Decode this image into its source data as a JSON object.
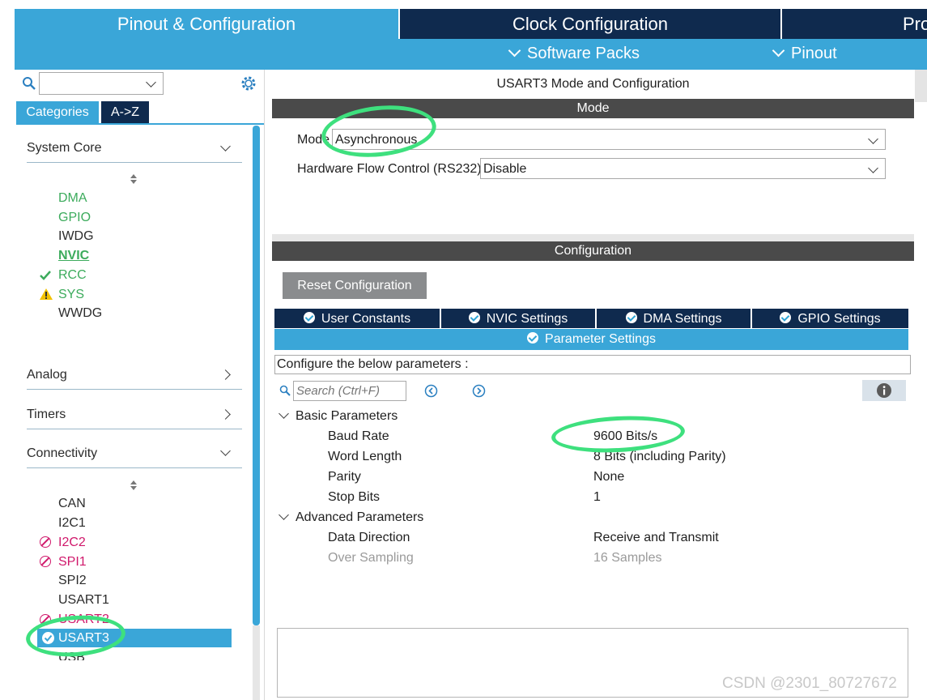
{
  "top_tabs": {
    "pinout": "Pinout & Configuration",
    "clock": "Clock Configuration",
    "project": "Pro"
  },
  "subbar": {
    "software_packs": "Software Packs",
    "pinout": "Pinout"
  },
  "sidebar": {
    "search_value": "",
    "tab_categories": "Categories",
    "tab_az": "A->Z",
    "system_core": "System Core",
    "system_core_items": [
      "DMA",
      "GPIO",
      "IWDG",
      "NVIC",
      "RCC",
      "SYS",
      "WWDG"
    ],
    "analog": "Analog",
    "timers": "Timers",
    "connectivity": "Connectivity",
    "connectivity_items": [
      "CAN",
      "I2C1",
      "I2C2",
      "SPI1",
      "SPI2",
      "USART1",
      "USART2",
      "USART3",
      "USB"
    ]
  },
  "panel": {
    "title": "USART3 Mode and Configuration",
    "mode_section": "Mode",
    "mode_label": "Mode",
    "mode_value": "Asynchronous",
    "hfc_label": "Hardware Flow Control (RS232)",
    "hfc_value": "Disable",
    "config_section": "Configuration",
    "reset_button": "Reset Configuration",
    "tabs": [
      "User Constants",
      "NVIC Settings",
      "DMA Settings",
      "GPIO Settings"
    ],
    "active_tab": "Parameter Settings",
    "configure_text": "Configure the below parameters :",
    "search_placeholder": "Search (Ctrl+F)",
    "basic_group": "Basic Parameters",
    "basic_params": [
      {
        "label": "Baud Rate",
        "value": "9600 Bits/s"
      },
      {
        "label": "Word Length",
        "value": "8 Bits (including Parity)"
      },
      {
        "label": "Parity",
        "value": "None"
      },
      {
        "label": "Stop Bits",
        "value": "1"
      }
    ],
    "advanced_group": "Advanced Parameters",
    "advanced_params": [
      {
        "label": "Data Direction",
        "value": "Receive and Transmit"
      },
      {
        "label": "Over Sampling",
        "value": "16 Samples"
      }
    ]
  },
  "watermark": "CSDN @2301_80727672",
  "colors": {
    "active_tab": "#3aa6d8",
    "dark_tab": "#0f2a4e",
    "section_bar": "#4a4a4a",
    "green_item": "#3cab5c",
    "pink_item": "#d0186b",
    "annotation": "#3ee07e"
  }
}
